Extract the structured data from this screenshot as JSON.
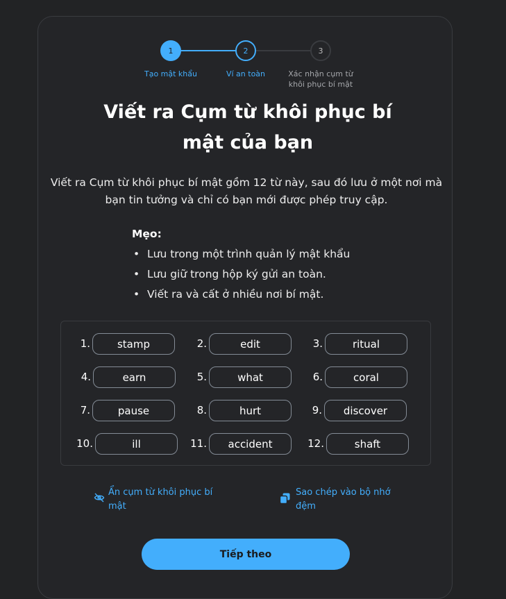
{
  "stepper": {
    "steps": [
      {
        "number": "1",
        "label": "Tạo mật khẩu"
      },
      {
        "number": "2",
        "label": "Ví an toàn"
      },
      {
        "number": "3",
        "label": "Xác nhận cụm từ khôi phục bí mật"
      }
    ],
    "current_step": 2
  },
  "title": "Viết ra Cụm từ khôi phục bí mật của bạn",
  "description": "Viết ra Cụm từ khôi phục bí mật gồm 12 từ này, sau đó lưu ở một nơi mà bạn tin tưởng và chỉ có bạn mới được phép truy cập.",
  "tips": {
    "heading": "Mẹo:",
    "items": [
      "Lưu trong một trình quản lý mật khẩu",
      "Lưu giữ trong hộp ký gửi an toàn.",
      "Viết ra và cất ở nhiều nơi bí mật."
    ]
  },
  "phrase": [
    {
      "num": "1.",
      "word": "stamp"
    },
    {
      "num": "2.",
      "word": "edit"
    },
    {
      "num": "3.",
      "word": "ritual"
    },
    {
      "num": "4.",
      "word": "earn"
    },
    {
      "num": "5.",
      "word": "what"
    },
    {
      "num": "6.",
      "word": "coral"
    },
    {
      "num": "7.",
      "word": "pause"
    },
    {
      "num": "8.",
      "word": "hurt"
    },
    {
      "num": "9.",
      "word": "discover"
    },
    {
      "num": "10.",
      "word": "ill"
    },
    {
      "num": "11.",
      "word": "accident"
    },
    {
      "num": "12.",
      "word": "shaft"
    }
  ],
  "actions": {
    "hide_label": "Ẩn cụm từ khôi phục bí mật",
    "hide_icon": "eye-slash-icon",
    "copy_label": "Sao chép vào bộ nhớ đệm",
    "copy_icon": "copy-icon"
  },
  "next_button": "Tiếp theo",
  "colors": {
    "accent": "#43aefc",
    "background": "#222325",
    "card": "#242528",
    "pill_border": "#848c96"
  }
}
